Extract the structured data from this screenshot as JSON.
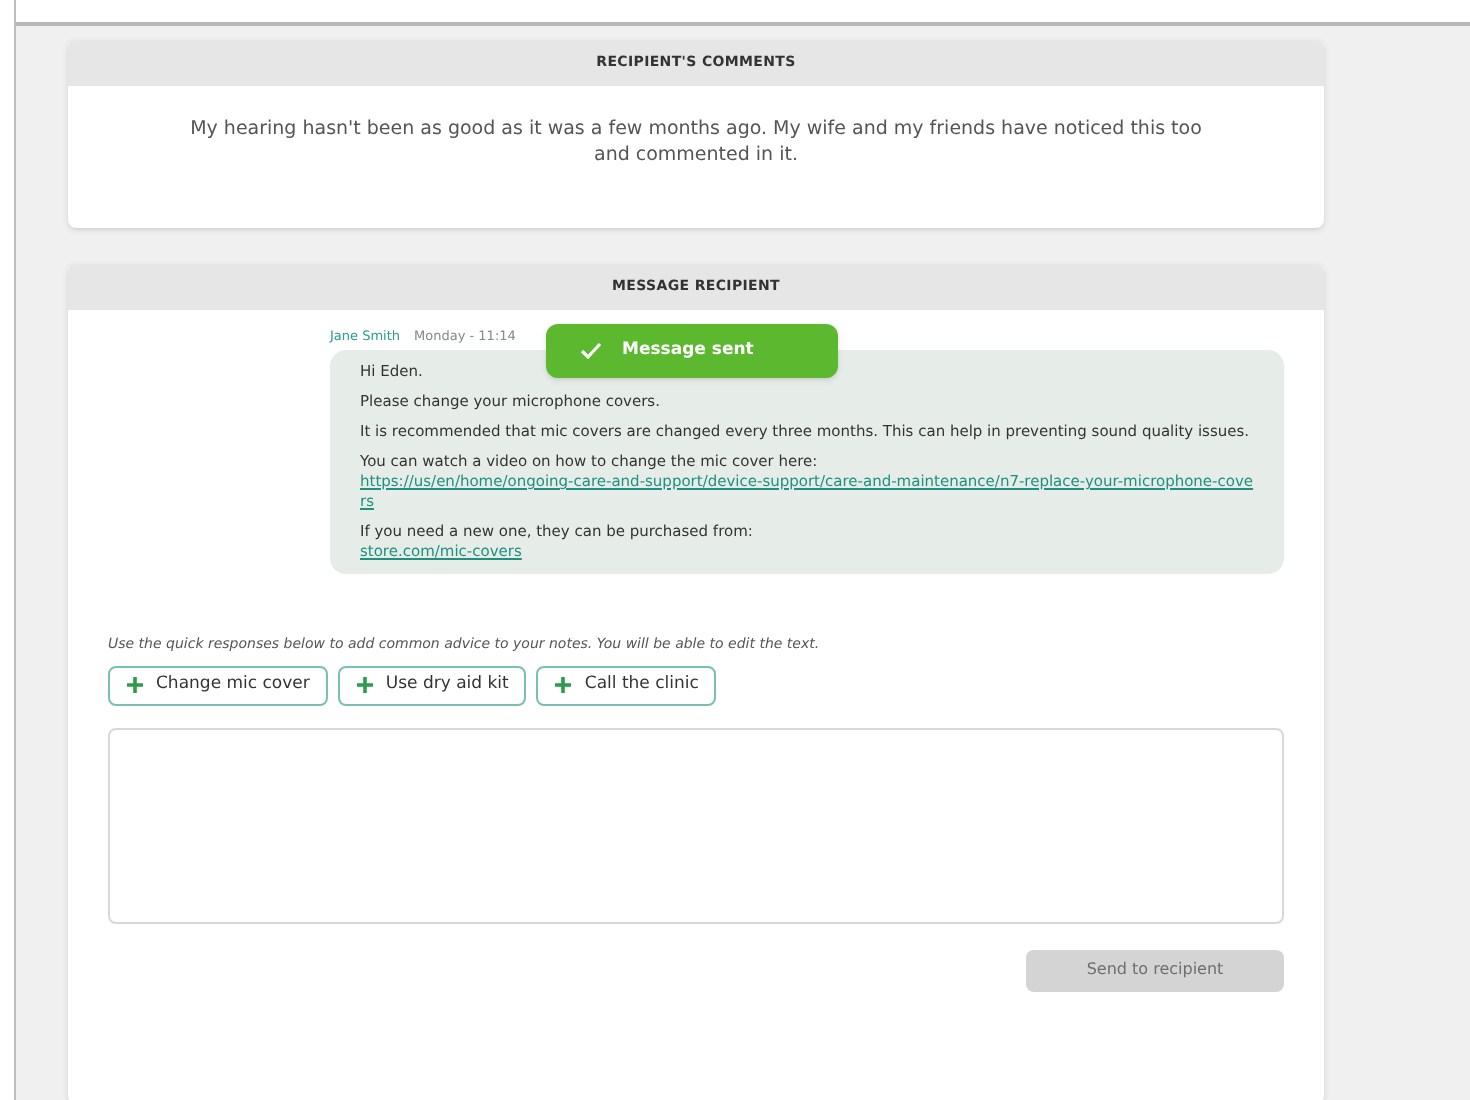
{
  "comments": {
    "title": "RECIPIENT'S COMMENTS",
    "text": "My hearing hasn't been as good as it was a few months ago. My wife and my friends have noticed this too and commented in it."
  },
  "message_panel": {
    "title": "MESSAGE RECIPIENT",
    "message": {
      "author": "Jane Smith",
      "time": "Monday - 11:14",
      "paragraphs": [
        {
          "kind": "text",
          "lines": [
            "Hi Eden."
          ]
        },
        {
          "kind": "text",
          "lines": [
            "Please change your microphone covers."
          ]
        },
        {
          "kind": "text",
          "lines": [
            "It is recommended that mic covers are changed every three months. This can help in preventing sound quality issues."
          ]
        },
        {
          "kind": "link",
          "lines": [
            "You can watch a video on how to change the mic cover here:",
            "https://us/en/home/ongoing-care-and-support/device-support/care-and-maintenance/n7-replace-your-microphone-covers"
          ]
        },
        {
          "kind": "link",
          "lines": [
            "If you need a new one, they can be purchased from:",
            "store.com/mic-covers"
          ]
        }
      ]
    },
    "toast": {
      "text": "Message sent"
    },
    "hint": "Use the quick responses below to add common advice to your notes. You will be able to edit the text.",
    "quick_responses": [
      "Change mic cover",
      "Use dry aid kit",
      "Call the clinic"
    ],
    "send_button": {
      "label": "Send to recipient",
      "disabled": true
    }
  }
}
